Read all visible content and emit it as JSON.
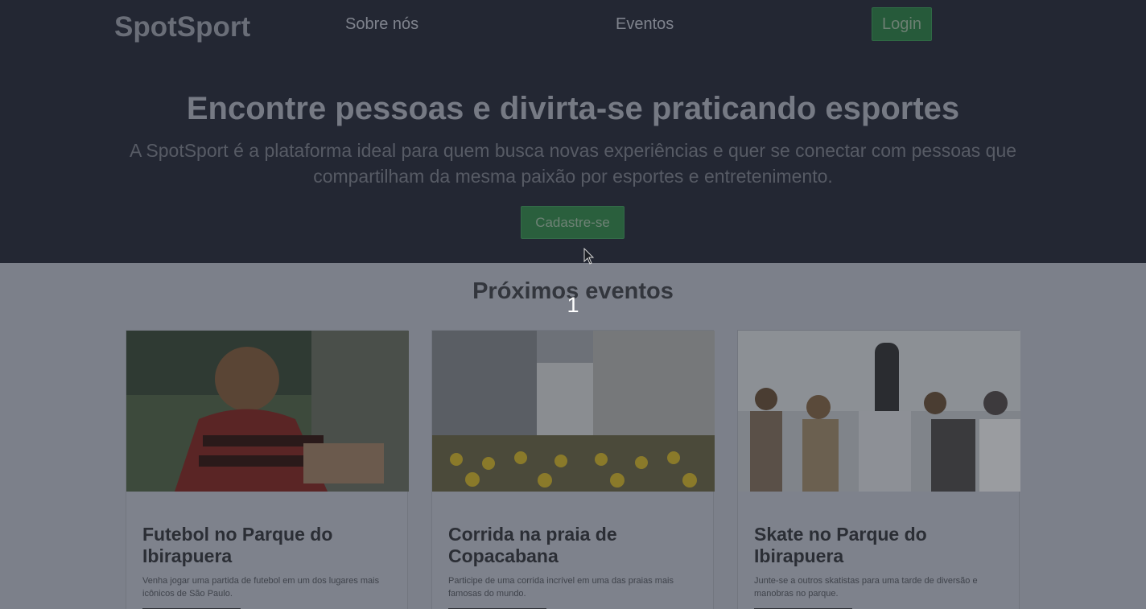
{
  "header": {
    "brand": "SpotSport",
    "nav": {
      "about": "Sobre nós",
      "events": "Eventos",
      "login": "Login"
    }
  },
  "hero": {
    "title": "Encontre pessoas e divirta-se praticando esportes",
    "subtitle": "A SpotSport é a plataforma ideal para quem busca novas experiências e quer se conectar com pessoas que compartilham da mesma paixão por esportes e entretenimento.",
    "cta": "Cadastre-se"
  },
  "events": {
    "title": "Próximos eventos",
    "overlay_number": "1",
    "cards": [
      {
        "title": "Futebol no Parque do Ibirapuera",
        "description": "Venha jogar uma partida de futebol em um dos lugares mais icônicos de São Paulo."
      },
      {
        "title": "Corrida na praia de Copacabana",
        "description": "Participe de uma corrida incrível em uma das praias mais famosas do mundo."
      },
      {
        "title": "Skate no Parque do Ibirapuera",
        "description": "Junte-se a outros skatistas para uma tarde de diversão e manobras no parque."
      }
    ]
  },
  "colors": {
    "accent_green": "#265a3a",
    "hero_bg": "#232733",
    "page_bg": "#7c808a"
  }
}
